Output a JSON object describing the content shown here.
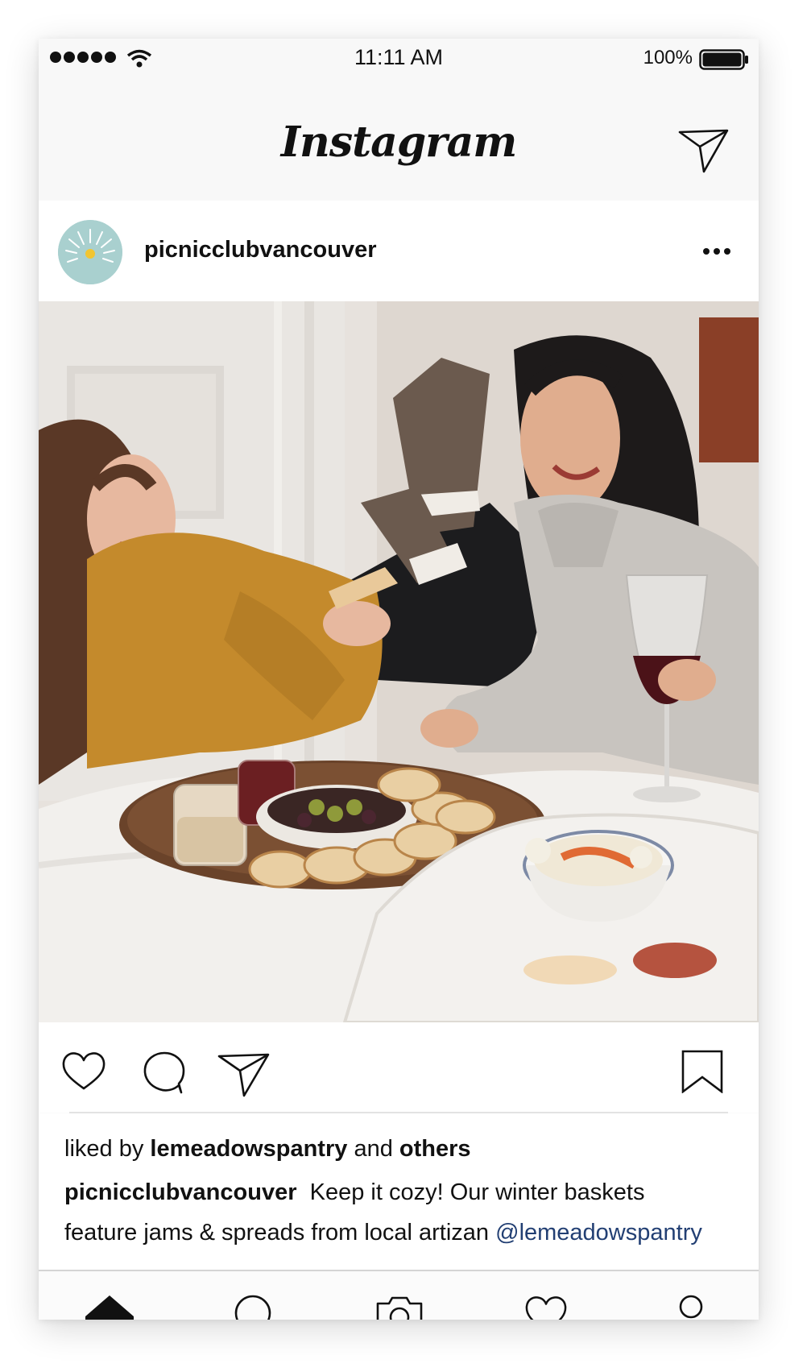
{
  "status_bar": {
    "time": "11:11 AM",
    "battery": "100%"
  },
  "header": {
    "logo": "Instagram"
  },
  "post": {
    "username": "picnicclubvancouver",
    "likes": {
      "prefix": "liked by",
      "user": "lemeadowspantry",
      "joiner": "and",
      "others": "others"
    },
    "caption": {
      "user": "picnicclubvancouver",
      "text_line1": "Keep it cozy! Our winter baskets",
      "text_line2": "feature jams & spreads from local artizan",
      "mention": "@lemeadowspantry"
    }
  },
  "icons": {
    "header": [
      "direct-message-icon"
    ],
    "post": [
      "more-options-icon"
    ],
    "actions": [
      "heart-icon",
      "comment-icon",
      "share-icon",
      "bookmark-icon"
    ],
    "tabs": [
      "home-icon",
      "search-icon",
      "camera-icon",
      "activity-heart-icon",
      "profile-icon"
    ]
  },
  "colors": {
    "avatar": "#a9d0cf",
    "mention": "#223f73"
  }
}
